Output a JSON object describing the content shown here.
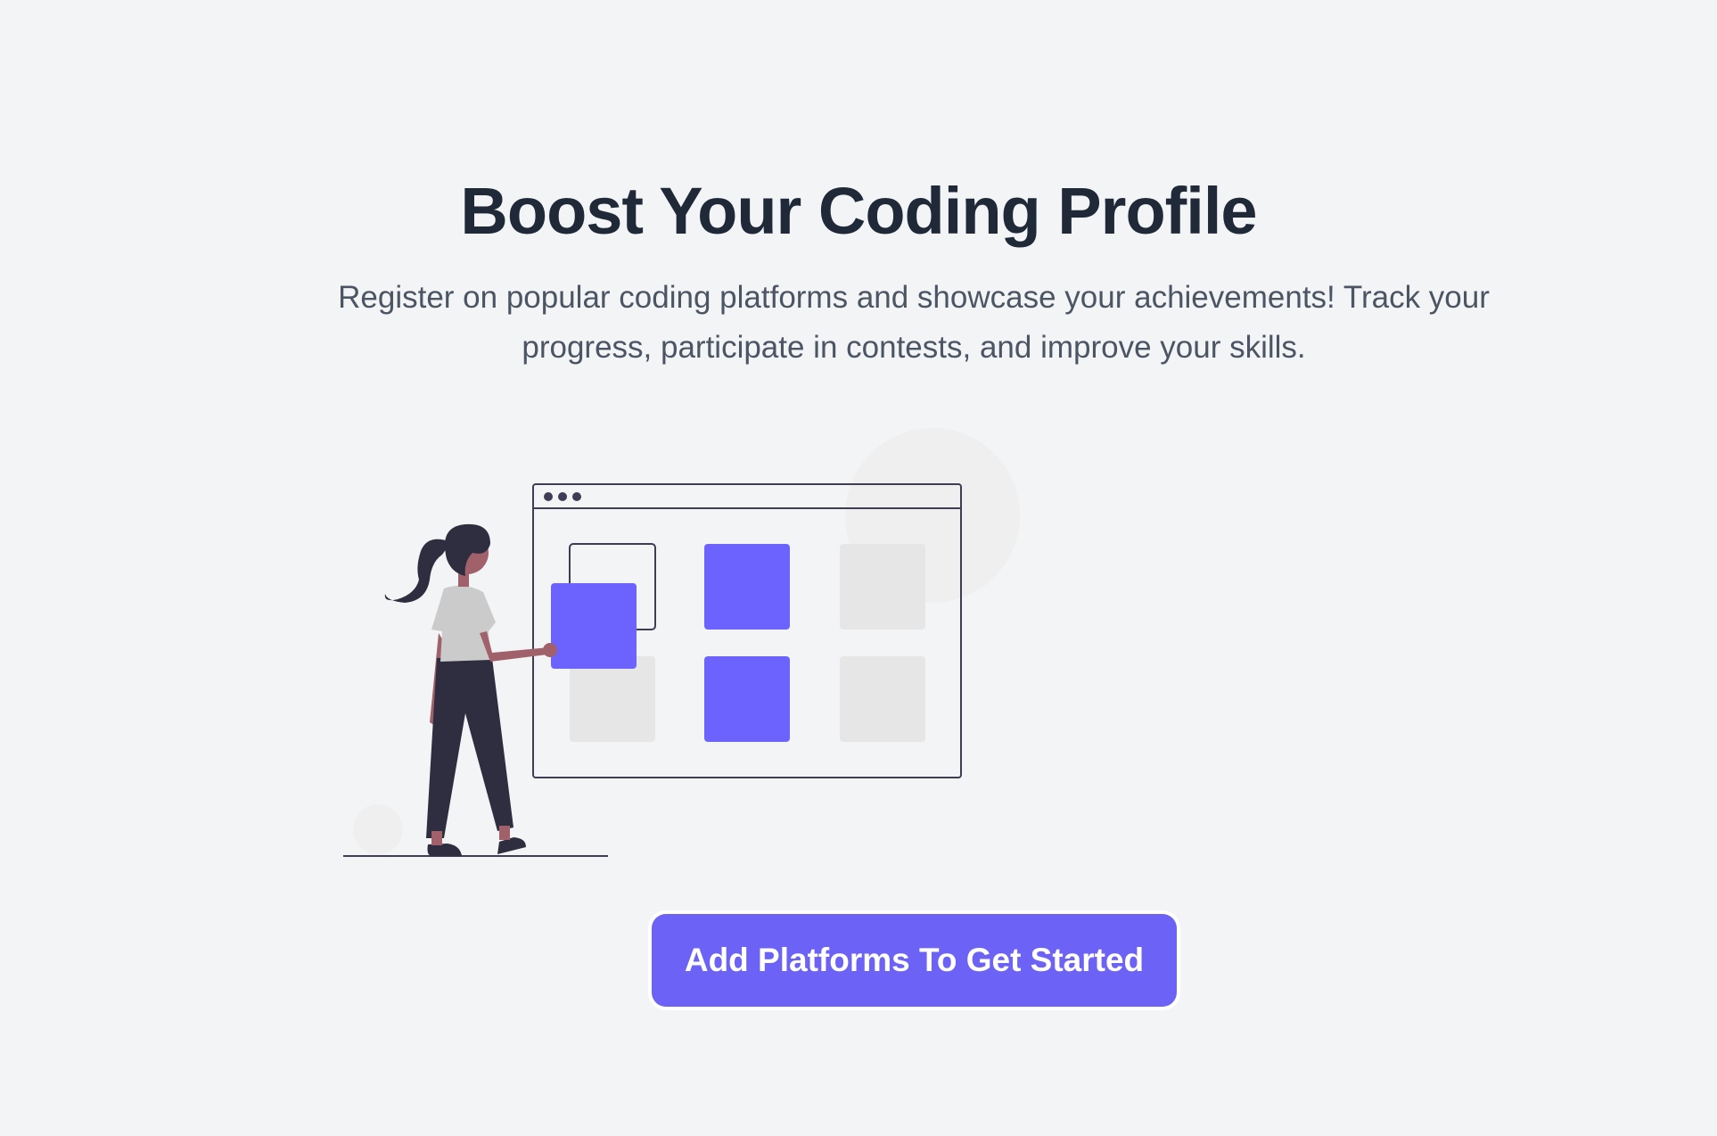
{
  "hero": {
    "title": "Boost Your Coding Profile",
    "subtitle": "Register on popular coding platforms and showcase your achievements! Track your progress, participate in contests, and improve your skills.",
    "cta_label": "Add Platforms To Get Started"
  },
  "illustration": {
    "icon": "woman-arranging-grid-illustration",
    "accent_color": "#6c63ff",
    "dark_color": "#2f2e41",
    "light_tile_color": "#e6e6e6"
  }
}
